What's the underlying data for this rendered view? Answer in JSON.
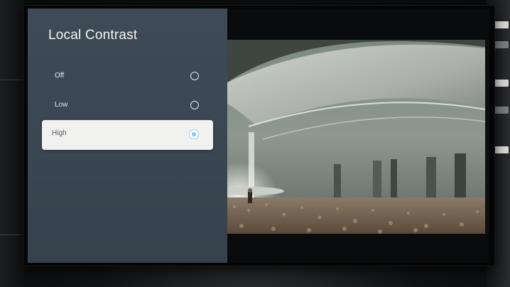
{
  "settings_panel": {
    "title": "Local Contrast",
    "options": [
      {
        "label": "Off",
        "selected": false
      },
      {
        "label": "Low",
        "selected": false
      },
      {
        "label": "High",
        "selected": true
      }
    ]
  },
  "colors": {
    "panel_bg": "#3c4853",
    "selected_bg": "#f1f1f0",
    "radio_accent": "#7ec8ea",
    "text": "#e6e9ec"
  },
  "preview": {
    "content": "concert-arena-scene"
  }
}
